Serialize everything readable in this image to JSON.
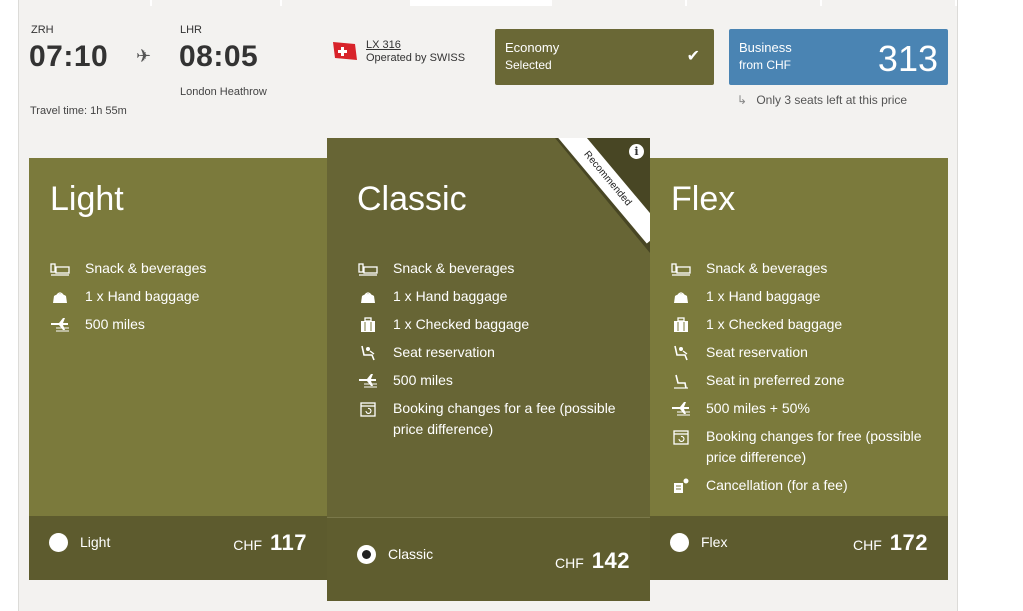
{
  "flight": {
    "from_code": "ZRH",
    "dep_time": "07:10",
    "to_code": "LHR",
    "arr_time": "08:05",
    "to_name": "London Heathrow",
    "travel_time": "Travel time: 1h 55m",
    "flight_number": "LX 316",
    "operated_by": "Operated by SWISS"
  },
  "cabins": {
    "economy": {
      "label": "Economy",
      "status": "Selected"
    },
    "business": {
      "label": "Business",
      "from": "from CHF",
      "price": "313"
    },
    "seats_note": "Only 3 seats left at this price"
  },
  "fares": [
    {
      "name": "Light",
      "features": [
        {
          "icon": "meal-icon",
          "text": "Snack & beverages"
        },
        {
          "icon": "hand-baggage-icon",
          "text": "1 x Hand baggage"
        },
        {
          "icon": "miles-icon",
          "text": "500 miles"
        }
      ],
      "radio_label": "Light",
      "currency": "CHF",
      "price": "117",
      "selected": false
    },
    {
      "name": "Classic",
      "ribbon": "Recommended",
      "features": [
        {
          "icon": "meal-icon",
          "text": "Snack & beverages"
        },
        {
          "icon": "hand-baggage-icon",
          "text": "1 x Hand baggage"
        },
        {
          "icon": "checked-baggage-icon",
          "text": "1 x Checked baggage"
        },
        {
          "icon": "seat-icon",
          "text": "Seat reservation"
        },
        {
          "icon": "miles-icon",
          "text": "500 miles"
        },
        {
          "icon": "calendar-change-icon",
          "text": "Booking changes for a fee (possible price difference)"
        }
      ],
      "radio_label": "Classic",
      "currency": "CHF",
      "price": "142",
      "selected": true
    },
    {
      "name": "Flex",
      "features": [
        {
          "icon": "meal-icon",
          "text": "Snack & beverages"
        },
        {
          "icon": "hand-baggage-icon",
          "text": "1 x Hand baggage"
        },
        {
          "icon": "checked-baggage-icon",
          "text": "1 x Checked baggage"
        },
        {
          "icon": "seat-icon",
          "text": "Seat reservation"
        },
        {
          "icon": "preferred-seat-icon",
          "text": "Seat in preferred zone"
        },
        {
          "icon": "miles-icon",
          "text": "500 miles + 50%"
        },
        {
          "icon": "calendar-change-icon",
          "text": "Booking changes for free (possible price difference)"
        },
        {
          "icon": "cancellation-icon",
          "text": "Cancellation (for a fee)"
        }
      ],
      "radio_label": "Flex",
      "currency": "CHF",
      "price": "172",
      "selected": false
    }
  ],
  "colors": {
    "fare_bg": "#7b7a3c",
    "fare_selected_bg": "#676535",
    "economy_bg": "#6a6836",
    "business_bg": "#4a84b3"
  }
}
